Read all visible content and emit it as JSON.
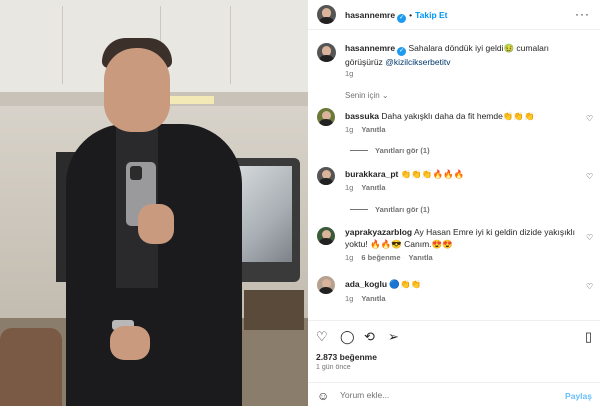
{
  "post": {
    "username": "hasannemre",
    "follow_label": "Takip Et",
    "more_icon": "more-horizontal-icon",
    "caption_text": "Sahalara döndük iyi geldi",
    "caption_emoji": "🤢",
    "caption_text2": "cumaları görüşürüz",
    "caption_mention": "@kizilcikserbetitv",
    "caption_time": "1g"
  },
  "sort_label": "Senin için ⌄",
  "comments": [
    {
      "username": "bassuka",
      "text": "Daha yakışklı daha da fit hemde👏👏👏",
      "time": "1g",
      "reply_label": "Yanıtla",
      "view_replies": "Yanıtları gör (1)"
    },
    {
      "username": "burakkara_pt",
      "text": "👏👏👏🔥🔥🔥",
      "time": "1g",
      "reply_label": "Yanıtla",
      "view_replies": "Yanıtları gör (1)"
    },
    {
      "username": "yaprakyazarblog",
      "text": "Ay Hasan Emre iyi ki geldin dizide yakışıklı yoktu! 🔥🔥😎 Canım.😍😍",
      "time": "1g",
      "likes": "6 beğenme",
      "reply_label": "Yanıtla"
    },
    {
      "username": "ada_koglu",
      "text": "🔵👏👏",
      "time": "1g",
      "reply_label": "Yanıtla"
    }
  ],
  "actions": {
    "like_icon": "heart-icon",
    "comment_icon": "comment-icon",
    "share_icon": "share-icon",
    "send_icon": "send-icon",
    "save_icon": "bookmark-icon"
  },
  "likes_count": "2.873 beğenme",
  "posted_time": "1 gün önce",
  "comment_box": {
    "placeholder": "Yorum ekle...",
    "post_label": "Paylaş",
    "emoji_icon": "emoji-icon"
  }
}
